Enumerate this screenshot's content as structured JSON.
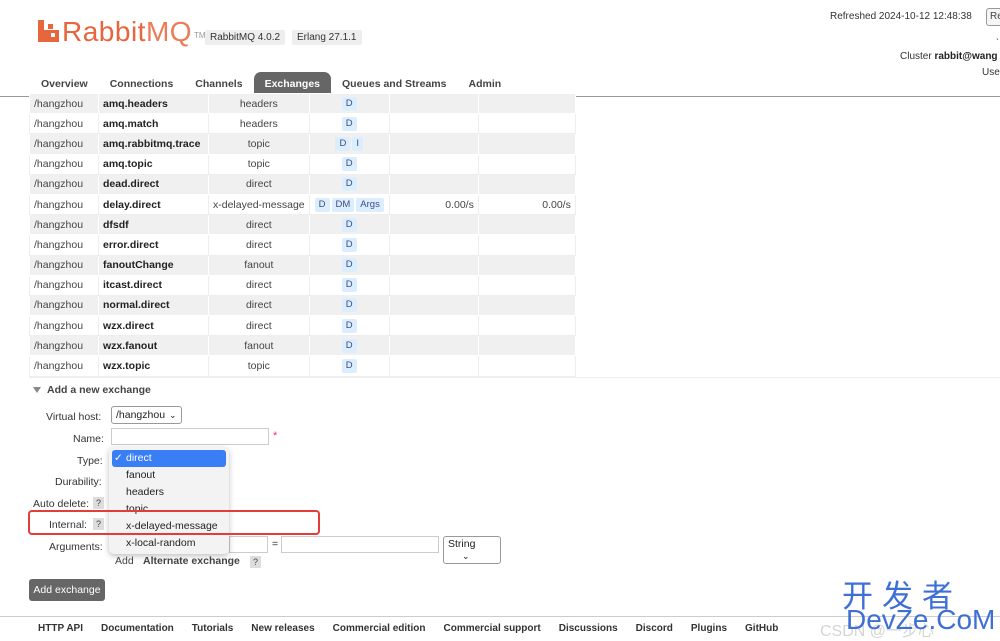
{
  "header": {
    "logo_text_rabbit": "Rabbit",
    "logo_text_mq": "MQ",
    "logo_tm": "TM",
    "version_rabbitmq": "RabbitMQ 4.0.2",
    "version_erlang": "Erlang 27.1.1",
    "refreshed": "Refreshed 2024-10-12 12:48:38",
    "refresh_button": "Re",
    "stray_char": "ˎ",
    "cluster_label": "Cluster ",
    "cluster_name": "rabbit@wang",
    "user_label": "Use"
  },
  "tabs": [
    "Overview",
    "Connections",
    "Channels",
    "Exchanges",
    "Queues and Streams",
    "Admin"
  ],
  "active_tab": "Exchanges",
  "exchanges": [
    {
      "vhost": "/hangzhou",
      "name": "amq.headers",
      "type": "headers",
      "features": [
        "D"
      ],
      "rate_in": "",
      "rate_out": ""
    },
    {
      "vhost": "/hangzhou",
      "name": "amq.match",
      "type": "headers",
      "features": [
        "D"
      ],
      "rate_in": "",
      "rate_out": ""
    },
    {
      "vhost": "/hangzhou",
      "name": "amq.rabbitmq.trace",
      "type": "topic",
      "features": [
        "D",
        "I"
      ],
      "rate_in": "",
      "rate_out": ""
    },
    {
      "vhost": "/hangzhou",
      "name": "amq.topic",
      "type": "topic",
      "features": [
        "D"
      ],
      "rate_in": "",
      "rate_out": ""
    },
    {
      "vhost": "/hangzhou",
      "name": "dead.direct",
      "type": "direct",
      "features": [
        "D"
      ],
      "rate_in": "",
      "rate_out": ""
    },
    {
      "vhost": "/hangzhou",
      "name": "delay.direct",
      "type": "x-delayed-message",
      "features": [
        "D",
        "DM",
        "Args"
      ],
      "rate_in": "0.00/s",
      "rate_out": "0.00/s"
    },
    {
      "vhost": "/hangzhou",
      "name": "dfsdf",
      "type": "direct",
      "features": [
        "D"
      ],
      "rate_in": "",
      "rate_out": ""
    },
    {
      "vhost": "/hangzhou",
      "name": "error.direct",
      "type": "direct",
      "features": [
        "D"
      ],
      "rate_in": "",
      "rate_out": ""
    },
    {
      "vhost": "/hangzhou",
      "name": "fanoutChange",
      "type": "fanout",
      "features": [
        "D"
      ],
      "rate_in": "",
      "rate_out": ""
    },
    {
      "vhost": "/hangzhou",
      "name": "itcast.direct",
      "type": "direct",
      "features": [
        "D"
      ],
      "rate_in": "",
      "rate_out": ""
    },
    {
      "vhost": "/hangzhou",
      "name": "normal.direct",
      "type": "direct",
      "features": [
        "D"
      ],
      "rate_in": "",
      "rate_out": ""
    },
    {
      "vhost": "/hangzhou",
      "name": "wzx.direct",
      "type": "direct",
      "features": [
        "D"
      ],
      "rate_in": "",
      "rate_out": ""
    },
    {
      "vhost": "/hangzhou",
      "name": "wzx.fanout",
      "type": "fanout",
      "features": [
        "D"
      ],
      "rate_in": "",
      "rate_out": ""
    },
    {
      "vhost": "/hangzhou",
      "name": "wzx.topic",
      "type": "topic",
      "features": [
        "D"
      ],
      "rate_in": "",
      "rate_out": ""
    }
  ],
  "add_exchange": {
    "section_title": "Add a new exchange",
    "virtual_host_label": "Virtual host:",
    "virtual_host_value": "/hangzhou",
    "name_label": "Name:",
    "name_value": "",
    "required_mark": "*",
    "type_label": "Type:",
    "durability_label": "Durability:",
    "auto_delete_label": "Auto delete:",
    "internal_label": "Internal:",
    "arguments_label": "Arguments:",
    "help_mark": "?",
    "equals": "=",
    "arg_type_value": "String",
    "add_link": "Add",
    "alternate_exchange": "Alternate exchange",
    "add_button": "Add exchange",
    "type_options": [
      "direct",
      "fanout",
      "headers",
      "topic",
      "x-delayed-message",
      "x-local-random"
    ],
    "type_selected": "direct",
    "check_mark": "✓"
  },
  "footer": [
    "HTTP API",
    "Documentation",
    "Tutorials",
    "New releases",
    "Commercial edition",
    "Commercial support",
    "Discussions",
    "Discord",
    "Plugins",
    "GitHub"
  ],
  "watermark": {
    "csdn": "CSDN @一步心",
    "cn": "开发者",
    "en": "DevZe.CoM"
  }
}
